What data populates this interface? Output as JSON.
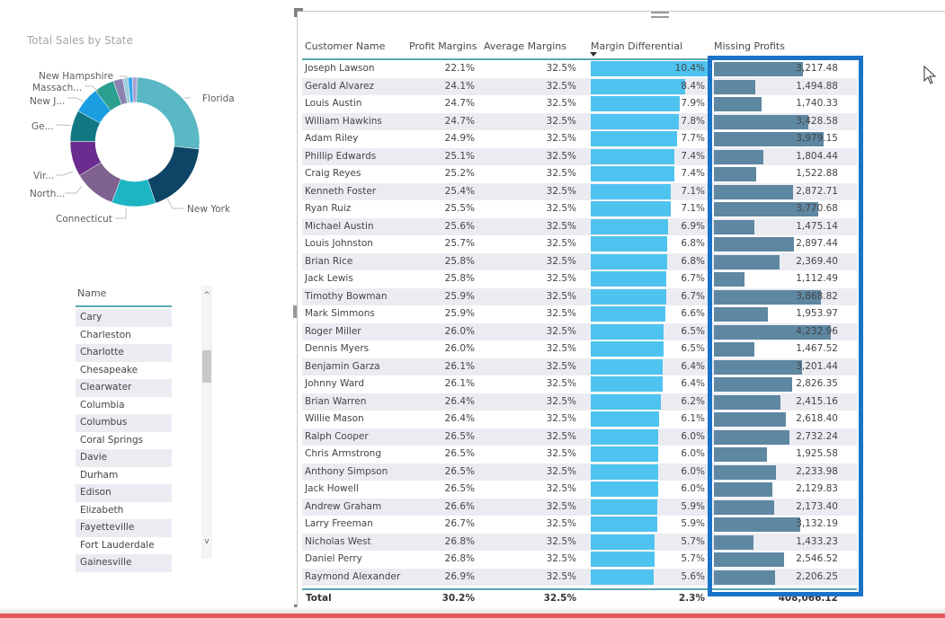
{
  "donut": {
    "title": "Total Sales by State",
    "labels": {
      "florida": "Florida",
      "new_york": "New York",
      "connecticut": "Connecticut",
      "north": "North...",
      "virginia": "Vir...",
      "georgia": "Ge...",
      "new_jersey": "New J...",
      "massachusetts": "Massach...",
      "new_hampshire": "New Hampshire"
    },
    "slices": [
      {
        "label": "Florida",
        "share": 0.262,
        "color": "#5ab8c4"
      },
      {
        "label": "New York",
        "share": 0.18,
        "color": "#0e4567"
      },
      {
        "label": "Connecticut",
        "share": 0.11,
        "color": "#1db4c4"
      },
      {
        "label": "North...",
        "share": 0.105,
        "color": "#7f628f"
      },
      {
        "label": "Vir...",
        "share": 0.088,
        "color": "#6a2c8e"
      },
      {
        "label": "Ge...",
        "share": 0.078,
        "color": "#117782"
      },
      {
        "label": "New J...",
        "share": 0.066,
        "color": "#1b9de2"
      },
      {
        "label": "Massach...",
        "share": 0.05,
        "color": "#2ba08f"
      },
      {
        "label": "other-1",
        "share": 0.024,
        "color": "#8a82b0"
      },
      {
        "label": "other-2",
        "share": 0.013,
        "color": "#9ccfdc"
      },
      {
        "label": "New Hampshire",
        "share": 0.011,
        "color": "#31a8f0"
      },
      {
        "label": "other-3",
        "share": 0.012,
        "color": "#a9a3d4"
      }
    ]
  },
  "slicer": {
    "header": "Name",
    "items": [
      "Cary",
      "Charleston",
      "Charlotte",
      "Chesapeake",
      "Clearwater",
      "Columbia",
      "Columbus",
      "Coral Springs",
      "Davie",
      "Durham",
      "Edison",
      "Elizabeth",
      "Fayetteville",
      "Fort Lauderdale",
      "Gainesville"
    ],
    "scroll_up": "^",
    "scroll_down": "v"
  },
  "table": {
    "headers": {
      "customer_name": "Customer Name",
      "profit_margins": "Profit Margins",
      "average_margins": "Average Margins",
      "margin_differential": "Margin Differential",
      "missing_profits": "Missing Profits"
    },
    "sorted_by": "Margin Differential",
    "rows": [
      {
        "name": "Joseph Lawson",
        "pm": "22.1%",
        "am": "32.5%",
        "md": "10.4%",
        "mp": "3,217.48",
        "md_val": 10.4,
        "mp_val": 3217.48
      },
      {
        "name": "Gerald Alvarez",
        "pm": "24.1%",
        "am": "32.5%",
        "md": "8.4%",
        "mp": "1,494.88",
        "md_val": 8.4,
        "mp_val": 1494.88
      },
      {
        "name": "Louis Austin",
        "pm": "24.7%",
        "am": "32.5%",
        "md": "7.9%",
        "mp": "1,740.33",
        "md_val": 7.9,
        "mp_val": 1740.33
      },
      {
        "name": "William Hawkins",
        "pm": "24.7%",
        "am": "32.5%",
        "md": "7.8%",
        "mp": "3,428.58",
        "md_val": 7.8,
        "mp_val": 3428.58
      },
      {
        "name": "Adam Riley",
        "pm": "24.9%",
        "am": "32.5%",
        "md": "7.7%",
        "mp": "3,979.15",
        "md_val": 7.7,
        "mp_val": 3979.15
      },
      {
        "name": "Phillip Edwards",
        "pm": "25.1%",
        "am": "32.5%",
        "md": "7.4%",
        "mp": "1,804.44",
        "md_val": 7.4,
        "mp_val": 1804.44
      },
      {
        "name": "Craig Reyes",
        "pm": "25.2%",
        "am": "32.5%",
        "md": "7.4%",
        "mp": "1,522.88",
        "md_val": 7.4,
        "mp_val": 1522.88
      },
      {
        "name": "Kenneth Foster",
        "pm": "25.4%",
        "am": "32.5%",
        "md": "7.1%",
        "mp": "2,872.71",
        "md_val": 7.1,
        "mp_val": 2872.71
      },
      {
        "name": "Ryan Ruiz",
        "pm": "25.5%",
        "am": "32.5%",
        "md": "7.1%",
        "mp": "3,770.68",
        "md_val": 7.1,
        "mp_val": 3770.68
      },
      {
        "name": "Michael Austin",
        "pm": "25.6%",
        "am": "32.5%",
        "md": "6.9%",
        "mp": "1,475.14",
        "md_val": 6.9,
        "mp_val": 1475.14
      },
      {
        "name": "Louis Johnston",
        "pm": "25.7%",
        "am": "32.5%",
        "md": "6.8%",
        "mp": "2,897.44",
        "md_val": 6.8,
        "mp_val": 2897.44
      },
      {
        "name": "Brian Rice",
        "pm": "25.8%",
        "am": "32.5%",
        "md": "6.8%",
        "mp": "2,369.40",
        "md_val": 6.8,
        "mp_val": 2369.4
      },
      {
        "name": "Jack Lewis",
        "pm": "25.8%",
        "am": "32.5%",
        "md": "6.7%",
        "mp": "1,112.49",
        "md_val": 6.7,
        "mp_val": 1112.49
      },
      {
        "name": "Timothy Bowman",
        "pm": "25.9%",
        "am": "32.5%",
        "md": "6.7%",
        "mp": "3,868.82",
        "md_val": 6.7,
        "mp_val": 3868.82
      },
      {
        "name": "Mark Simmons",
        "pm": "25.9%",
        "am": "32.5%",
        "md": "6.6%",
        "mp": "1,953.97",
        "md_val": 6.6,
        "mp_val": 1953.97
      },
      {
        "name": "Roger Miller",
        "pm": "26.0%",
        "am": "32.5%",
        "md": "6.5%",
        "mp": "4,232.96",
        "md_val": 6.5,
        "mp_val": 4232.96
      },
      {
        "name": "Dennis Myers",
        "pm": "26.0%",
        "am": "32.5%",
        "md": "6.5%",
        "mp": "1,467.52",
        "md_val": 6.5,
        "mp_val": 1467.52
      },
      {
        "name": "Benjamin Garza",
        "pm": "26.1%",
        "am": "32.5%",
        "md": "6.4%",
        "mp": "3,201.44",
        "md_val": 6.4,
        "mp_val": 3201.44
      },
      {
        "name": "Johnny Ward",
        "pm": "26.1%",
        "am": "32.5%",
        "md": "6.4%",
        "mp": "2,826.35",
        "md_val": 6.4,
        "mp_val": 2826.35
      },
      {
        "name": "Brian Warren",
        "pm": "26.4%",
        "am": "32.5%",
        "md": "6.2%",
        "mp": "2,415.16",
        "md_val": 6.2,
        "mp_val": 2415.16
      },
      {
        "name": "Willie Mason",
        "pm": "26.4%",
        "am": "32.5%",
        "md": "6.1%",
        "mp": "2,618.40",
        "md_val": 6.1,
        "mp_val": 2618.4
      },
      {
        "name": "Ralph Cooper",
        "pm": "26.5%",
        "am": "32.5%",
        "md": "6.0%",
        "mp": "2,732.24",
        "md_val": 6.0,
        "mp_val": 2732.24
      },
      {
        "name": "Chris Armstrong",
        "pm": "26.5%",
        "am": "32.5%",
        "md": "6.0%",
        "mp": "1,925.58",
        "md_val": 6.0,
        "mp_val": 1925.58
      },
      {
        "name": "Anthony Simpson",
        "pm": "26.5%",
        "am": "32.5%",
        "md": "6.0%",
        "mp": "2,233.98",
        "md_val": 6.0,
        "mp_val": 2233.98
      },
      {
        "name": "Jack Howell",
        "pm": "26.5%",
        "am": "32.5%",
        "md": "6.0%",
        "mp": "2,129.83",
        "md_val": 6.0,
        "mp_val": 2129.83
      },
      {
        "name": "Andrew Graham",
        "pm": "26.6%",
        "am": "32.5%",
        "md": "5.9%",
        "mp": "2,173.40",
        "md_val": 5.9,
        "mp_val": 2173.4
      },
      {
        "name": "Larry Freeman",
        "pm": "26.7%",
        "am": "32.5%",
        "md": "5.9%",
        "mp": "3,132.19",
        "md_val": 5.9,
        "mp_val": 3132.19
      },
      {
        "name": "Nicholas West",
        "pm": "26.8%",
        "am": "32.5%",
        "md": "5.7%",
        "mp": "1,433.23",
        "md_val": 5.7,
        "mp_val": 1433.23
      },
      {
        "name": "Daniel Perry",
        "pm": "26.8%",
        "am": "32.5%",
        "md": "5.7%",
        "mp": "2,546.52",
        "md_val": 5.7,
        "mp_val": 2546.52
      },
      {
        "name": "Raymond Alexander",
        "pm": "26.9%",
        "am": "32.5%",
        "md": "5.6%",
        "mp": "2,206.25",
        "md_val": 5.6,
        "mp_val": 2206.25
      }
    ],
    "total": {
      "label": "Total",
      "pm": "30.2%",
      "am": "32.5%",
      "md": "2.3%",
      "mp": "408,066.12"
    }
  },
  "colors": {
    "md_bar": "#4fc3ef",
    "mp_bar": "#5e87a2",
    "highlight": "#1a73c8",
    "accent_line": "#5aa7b0"
  }
}
